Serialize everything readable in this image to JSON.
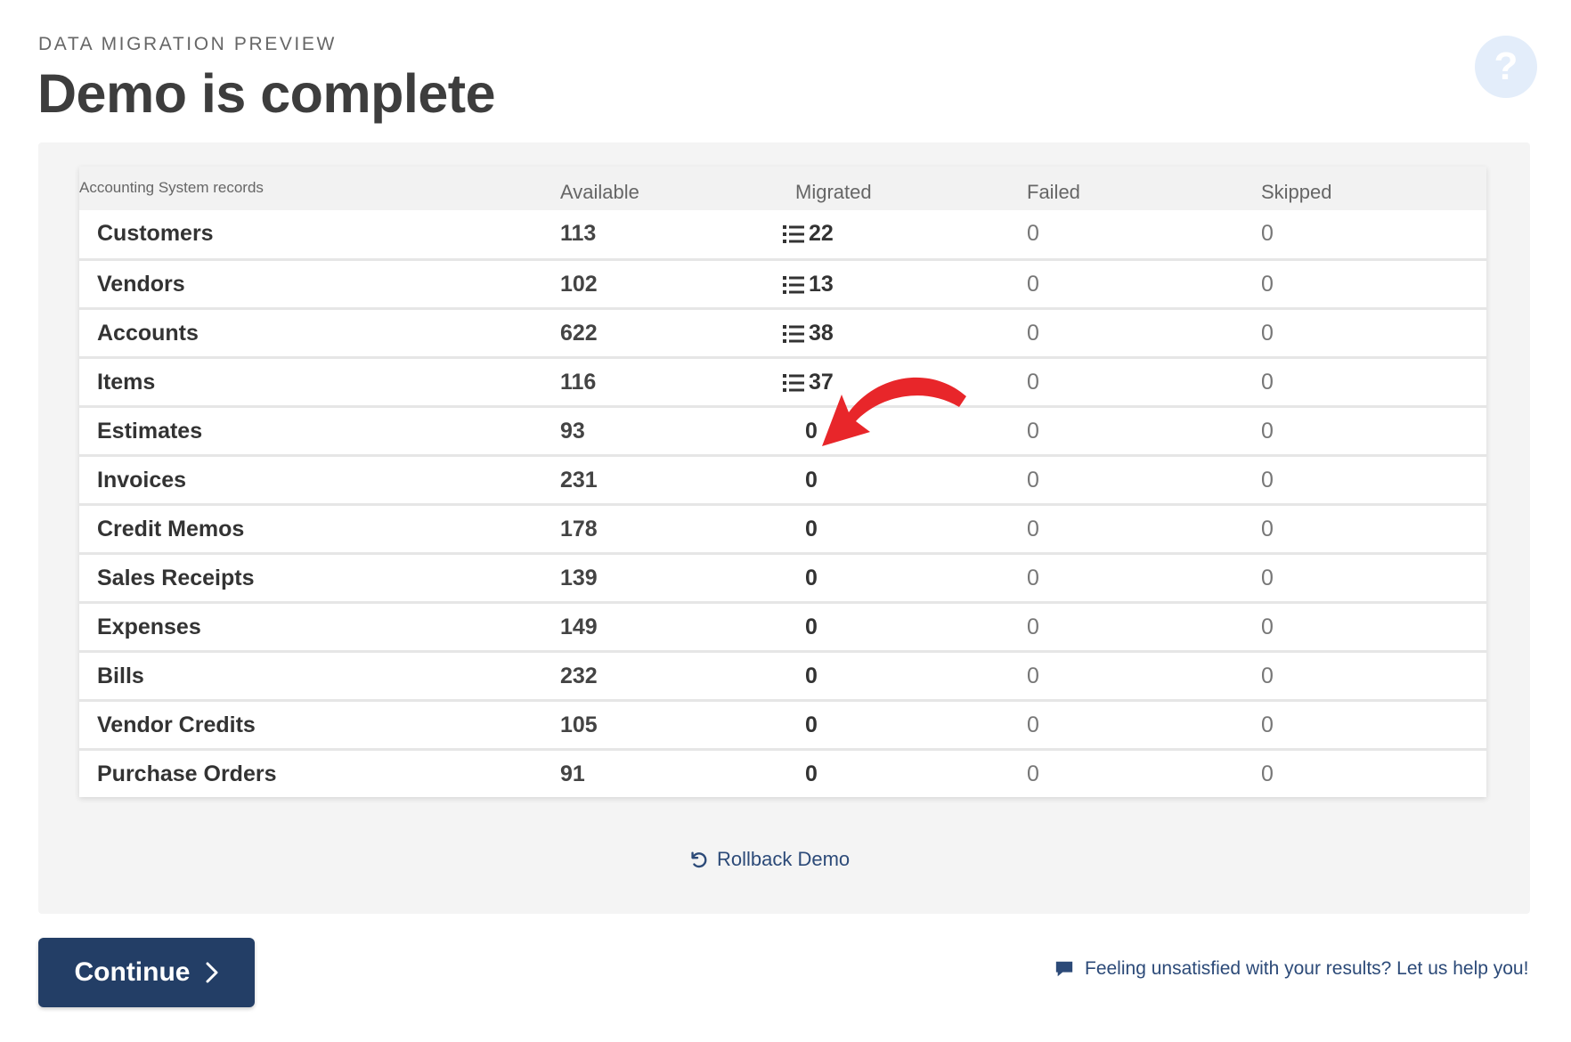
{
  "header": {
    "eyebrow": "DATA MIGRATION PREVIEW",
    "title": "Demo is complete",
    "help_icon": "question-mark-icon",
    "help_glyph": "?"
  },
  "table": {
    "columns": [
      "Accounting System records",
      "Available",
      "Migrated",
      "Failed",
      "Skipped"
    ],
    "rows": [
      {
        "name": "Customers",
        "available": "113",
        "migrated": "22",
        "failed": "0",
        "skipped": "0",
        "has_list": true
      },
      {
        "name": "Vendors",
        "available": "102",
        "migrated": "13",
        "failed": "0",
        "skipped": "0",
        "has_list": true
      },
      {
        "name": "Accounts",
        "available": "622",
        "migrated": "38",
        "failed": "0",
        "skipped": "0",
        "has_list": true
      },
      {
        "name": "Items",
        "available": "116",
        "migrated": "37",
        "failed": "0",
        "skipped": "0",
        "has_list": true
      },
      {
        "name": "Estimates",
        "available": "93",
        "migrated": "0",
        "failed": "0",
        "skipped": "0",
        "has_list": false
      },
      {
        "name": "Invoices",
        "available": "231",
        "migrated": "0",
        "failed": "0",
        "skipped": "0",
        "has_list": false
      },
      {
        "name": "Credit Memos",
        "available": "178",
        "migrated": "0",
        "failed": "0",
        "skipped": "0",
        "has_list": false
      },
      {
        "name": "Sales Receipts",
        "available": "139",
        "migrated": "0",
        "failed": "0",
        "skipped": "0",
        "has_list": false
      },
      {
        "name": "Expenses",
        "available": "149",
        "migrated": "0",
        "failed": "0",
        "skipped": "0",
        "has_list": false
      },
      {
        "name": "Bills",
        "available": "232",
        "migrated": "0",
        "failed": "0",
        "skipped": "0",
        "has_list": false
      },
      {
        "name": "Vendor Credits",
        "available": "105",
        "migrated": "0",
        "failed": "0",
        "skipped": "0",
        "has_list": false
      },
      {
        "name": "Purchase Orders",
        "available": "91",
        "migrated": "0",
        "failed": "0",
        "skipped": "0",
        "has_list": false
      }
    ]
  },
  "actions": {
    "rollback_label": "Rollback Demo",
    "continue_label": "Continue",
    "help_link_label": "Feeling unsatisfied with your results? Let us help you!"
  },
  "colors": {
    "primary_button": "#233e66",
    "link": "#2c4a78",
    "annotation_arrow": "#e8262a",
    "panel_bg": "#f4f4f4"
  },
  "icons": [
    "question-mark-icon",
    "list-icon",
    "rollback-icon",
    "chevron-right-icon",
    "chat-bubble-icon",
    "annotation-arrow"
  ]
}
